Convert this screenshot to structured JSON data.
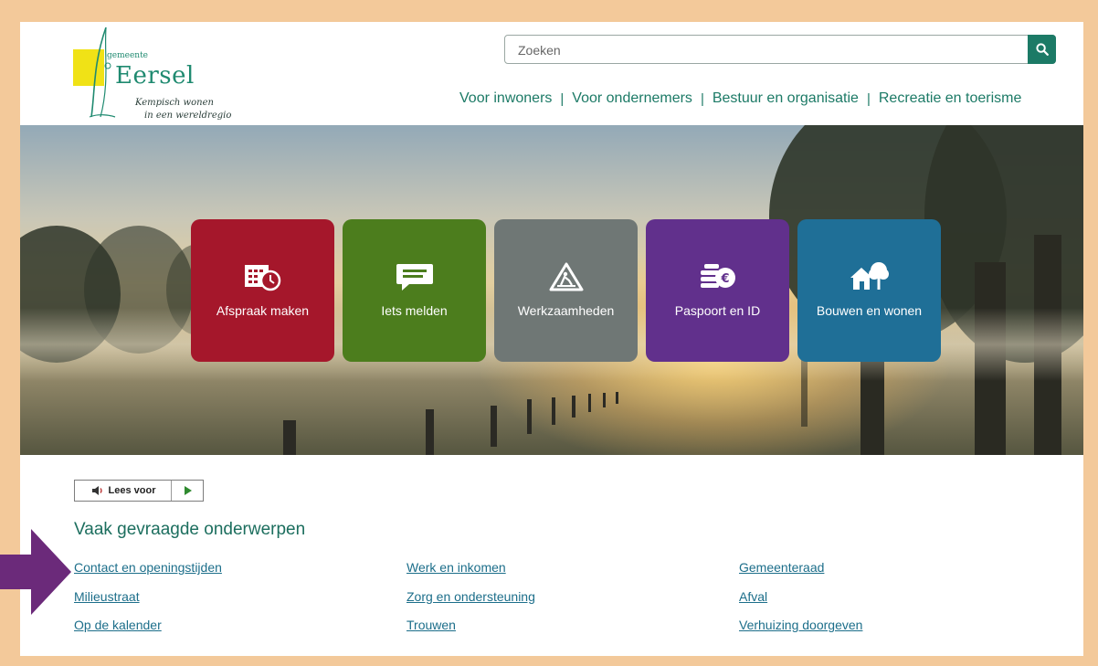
{
  "logo": {
    "small": "gemeente",
    "name": "Eersel",
    "tagline_1": "Kempisch wonen",
    "tagline_2": "in een wereldregio"
  },
  "search": {
    "placeholder": "Zoeken",
    "button_icon": "search-icon"
  },
  "topnav": [
    "Voor inwoners",
    "Voor ondernemers",
    "Bestuur en organisatie",
    "Recreatie en toerisme"
  ],
  "tiles": [
    {
      "label": "Afspraak maken",
      "color": "#a5172b",
      "icon": "calendar-clock-icon"
    },
    {
      "label": "Iets melden",
      "color": "#4c7d1d",
      "icon": "speech-bubble-icon"
    },
    {
      "label": "Werkzaamheden",
      "color": "#6f7775",
      "icon": "road-works-icon"
    },
    {
      "label": "Paspoort en ID",
      "color": "#61308c",
      "icon": "coins-icon"
    },
    {
      "label": "Bouwen en wonen",
      "color": "#1f6f97",
      "icon": "house-tree-icon"
    }
  ],
  "lees_voor": {
    "label": "Lees voor",
    "icon": "speaker-icon",
    "play_icon": "play-icon"
  },
  "faq": {
    "title": "Vaak gevraagde onderwerpen",
    "columns": [
      [
        "Contact en openingstijden",
        "Milieustraat",
        "Op de kalender"
      ],
      [
        "Werk en inkomen",
        "Zorg en ondersteuning",
        "Trouwen"
      ],
      [
        "Gemeenteraad",
        "Afval",
        "Verhuizing doorgeven"
      ]
    ]
  },
  "colors": {
    "frame": "#f3c99a",
    "brand_green": "#1c7a66",
    "arrow": "#6b2a7a"
  }
}
